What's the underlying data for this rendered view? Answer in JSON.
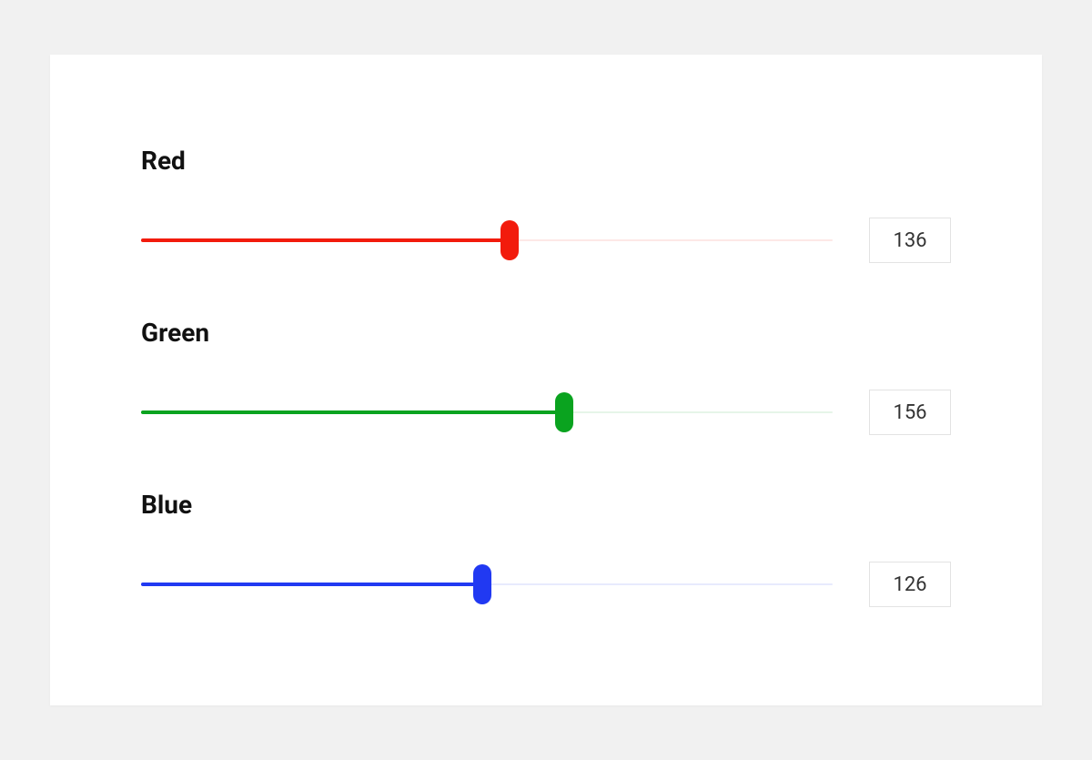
{
  "sliders": {
    "max": 255,
    "red": {
      "label": "Red",
      "value": 136,
      "percent": 53.3,
      "color": "#f21b0c",
      "track_bg": "#fde8e6"
    },
    "green": {
      "label": "Green",
      "value": 156,
      "percent": 61.2,
      "color": "#0aa31f",
      "track_bg": "#e6f5e8"
    },
    "blue": {
      "label": "Blue",
      "value": 126,
      "percent": 49.4,
      "color": "#2139f2",
      "track_bg": "#e8eafd"
    }
  }
}
